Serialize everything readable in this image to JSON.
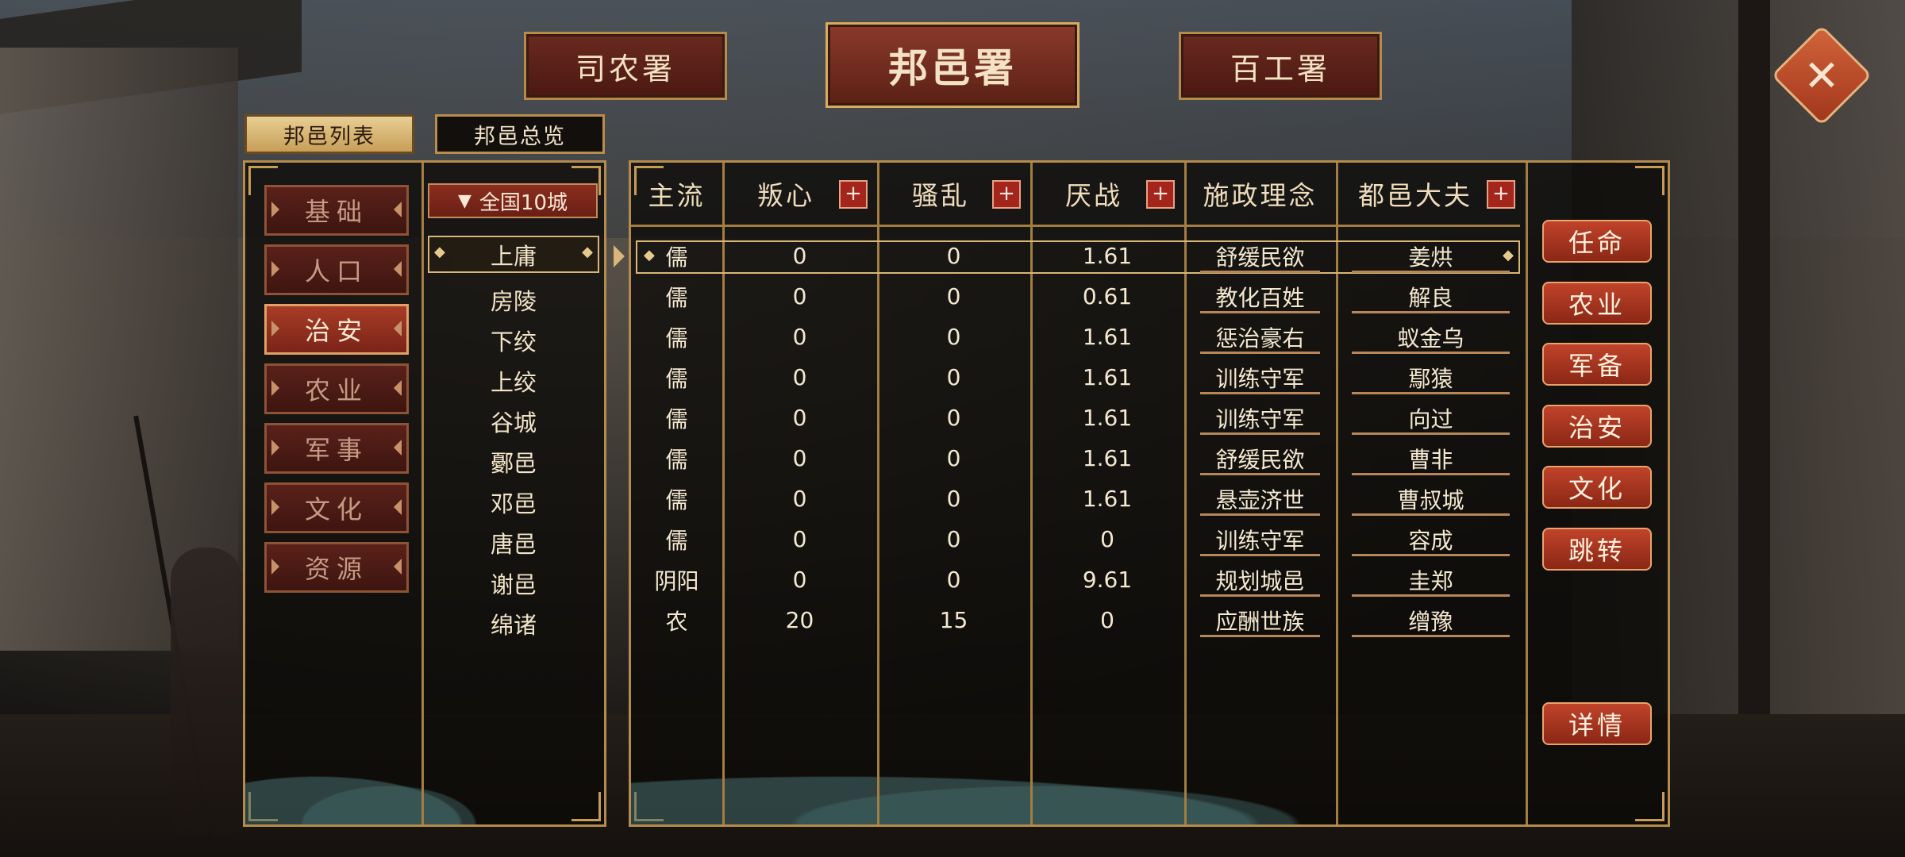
{
  "header": {
    "tabs": [
      {
        "label": "司农署"
      },
      {
        "label": "邦邑署"
      },
      {
        "label": "百工署"
      }
    ]
  },
  "subtabs": [
    {
      "label": "邦邑列表"
    },
    {
      "label": "邦邑总览"
    }
  ],
  "categories": [
    {
      "label": "基础"
    },
    {
      "label": "人口"
    },
    {
      "label": "治安"
    },
    {
      "label": "农业"
    },
    {
      "label": "军事"
    },
    {
      "label": "文化"
    },
    {
      "label": "资源"
    }
  ],
  "active_category": "治安",
  "filter": {
    "label": "全国10城",
    "icon": "triangle-down-icon"
  },
  "columns": [
    "主流",
    "叛心",
    "骚乱",
    "厌战",
    "施政理念",
    "都邑大夫"
  ],
  "cities": [
    {
      "name": "上庸",
      "school": "儒",
      "rebel": "0",
      "riot": "0",
      "weariness": "1.61",
      "policy": "舒缓民欲",
      "governor": "姜烘"
    },
    {
      "name": "房陵",
      "school": "儒",
      "rebel": "0",
      "riot": "0",
      "weariness": "0.61",
      "policy": "教化百姓",
      "governor": "解良"
    },
    {
      "name": "下绞",
      "school": "儒",
      "rebel": "0",
      "riot": "0",
      "weariness": "1.61",
      "policy": "惩治豪右",
      "governor": "蚁金乌"
    },
    {
      "name": "上绞",
      "school": "儒",
      "rebel": "0",
      "riot": "0",
      "weariness": "1.61",
      "policy": "训练守军",
      "governor": "鄢猿"
    },
    {
      "name": "谷城",
      "school": "儒",
      "rebel": "0",
      "riot": "0",
      "weariness": "1.61",
      "policy": "训练守军",
      "governor": "向过"
    },
    {
      "name": "鄾邑",
      "school": "儒",
      "rebel": "0",
      "riot": "0",
      "weariness": "1.61",
      "policy": "舒缓民欲",
      "governor": "曹非"
    },
    {
      "name": "邓邑",
      "school": "儒",
      "rebel": "0",
      "riot": "0",
      "weariness": "1.61",
      "policy": "悬壶济世",
      "governor": "曹叔城"
    },
    {
      "name": "唐邑",
      "school": "儒",
      "rebel": "0",
      "riot": "0",
      "weariness": "0",
      "policy": "训练守军",
      "governor": "容成"
    },
    {
      "name": "谢邑",
      "school": "阴阳",
      "rebel": "0",
      "riot": "0",
      "weariness": "9.61",
      "policy": "规划城邑",
      "governor": "圭郑"
    },
    {
      "name": "绵诸",
      "school": "农",
      "rebel": "20",
      "riot": "15",
      "weariness": "0",
      "policy": "应酬世族",
      "governor": "缯豫"
    }
  ],
  "selected_city": "上庸",
  "actions": [
    {
      "label": "任命"
    },
    {
      "label": "农业"
    },
    {
      "label": "军备"
    },
    {
      "label": "治安"
    },
    {
      "label": "文化"
    },
    {
      "label": "跳转"
    }
  ],
  "detail_button": {
    "label": "详情"
  },
  "plus_symbol": "+",
  "close_symbol": "✕",
  "colors": {
    "accent_gold": "#b48b4c",
    "button_red": "#a83c26"
  }
}
